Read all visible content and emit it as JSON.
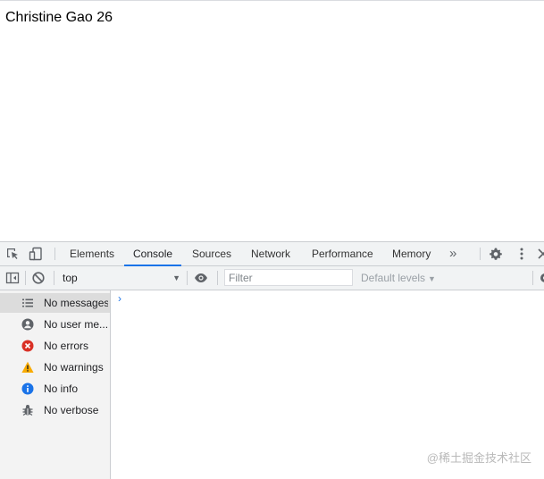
{
  "page": {
    "text": "Christine Gao 26"
  },
  "devtools": {
    "tabs": [
      "Elements",
      "Console",
      "Sources",
      "Network",
      "Performance",
      "Memory"
    ],
    "more_tabs": "»",
    "active_tab": "Console"
  },
  "toolbar": {
    "context": "top",
    "filter_placeholder": "Filter",
    "levels": "Default levels"
  },
  "sidebar": {
    "items": [
      {
        "label": "No messages",
        "icon": "list-icon"
      },
      {
        "label": "No user me...",
        "icon": "user-icon"
      },
      {
        "label": "No errors",
        "icon": "error-icon"
      },
      {
        "label": "No warnings",
        "icon": "warning-icon"
      },
      {
        "label": "No info",
        "icon": "info-icon"
      },
      {
        "label": "No verbose",
        "icon": "bug-icon"
      }
    ]
  },
  "console": {
    "prompt": "›"
  },
  "watermark": "@稀土掘金技术社区",
  "colors": {
    "accent": "#1a73e8",
    "error": "#d93025",
    "warning": "#f9ab00",
    "info": "#1a73e8"
  }
}
